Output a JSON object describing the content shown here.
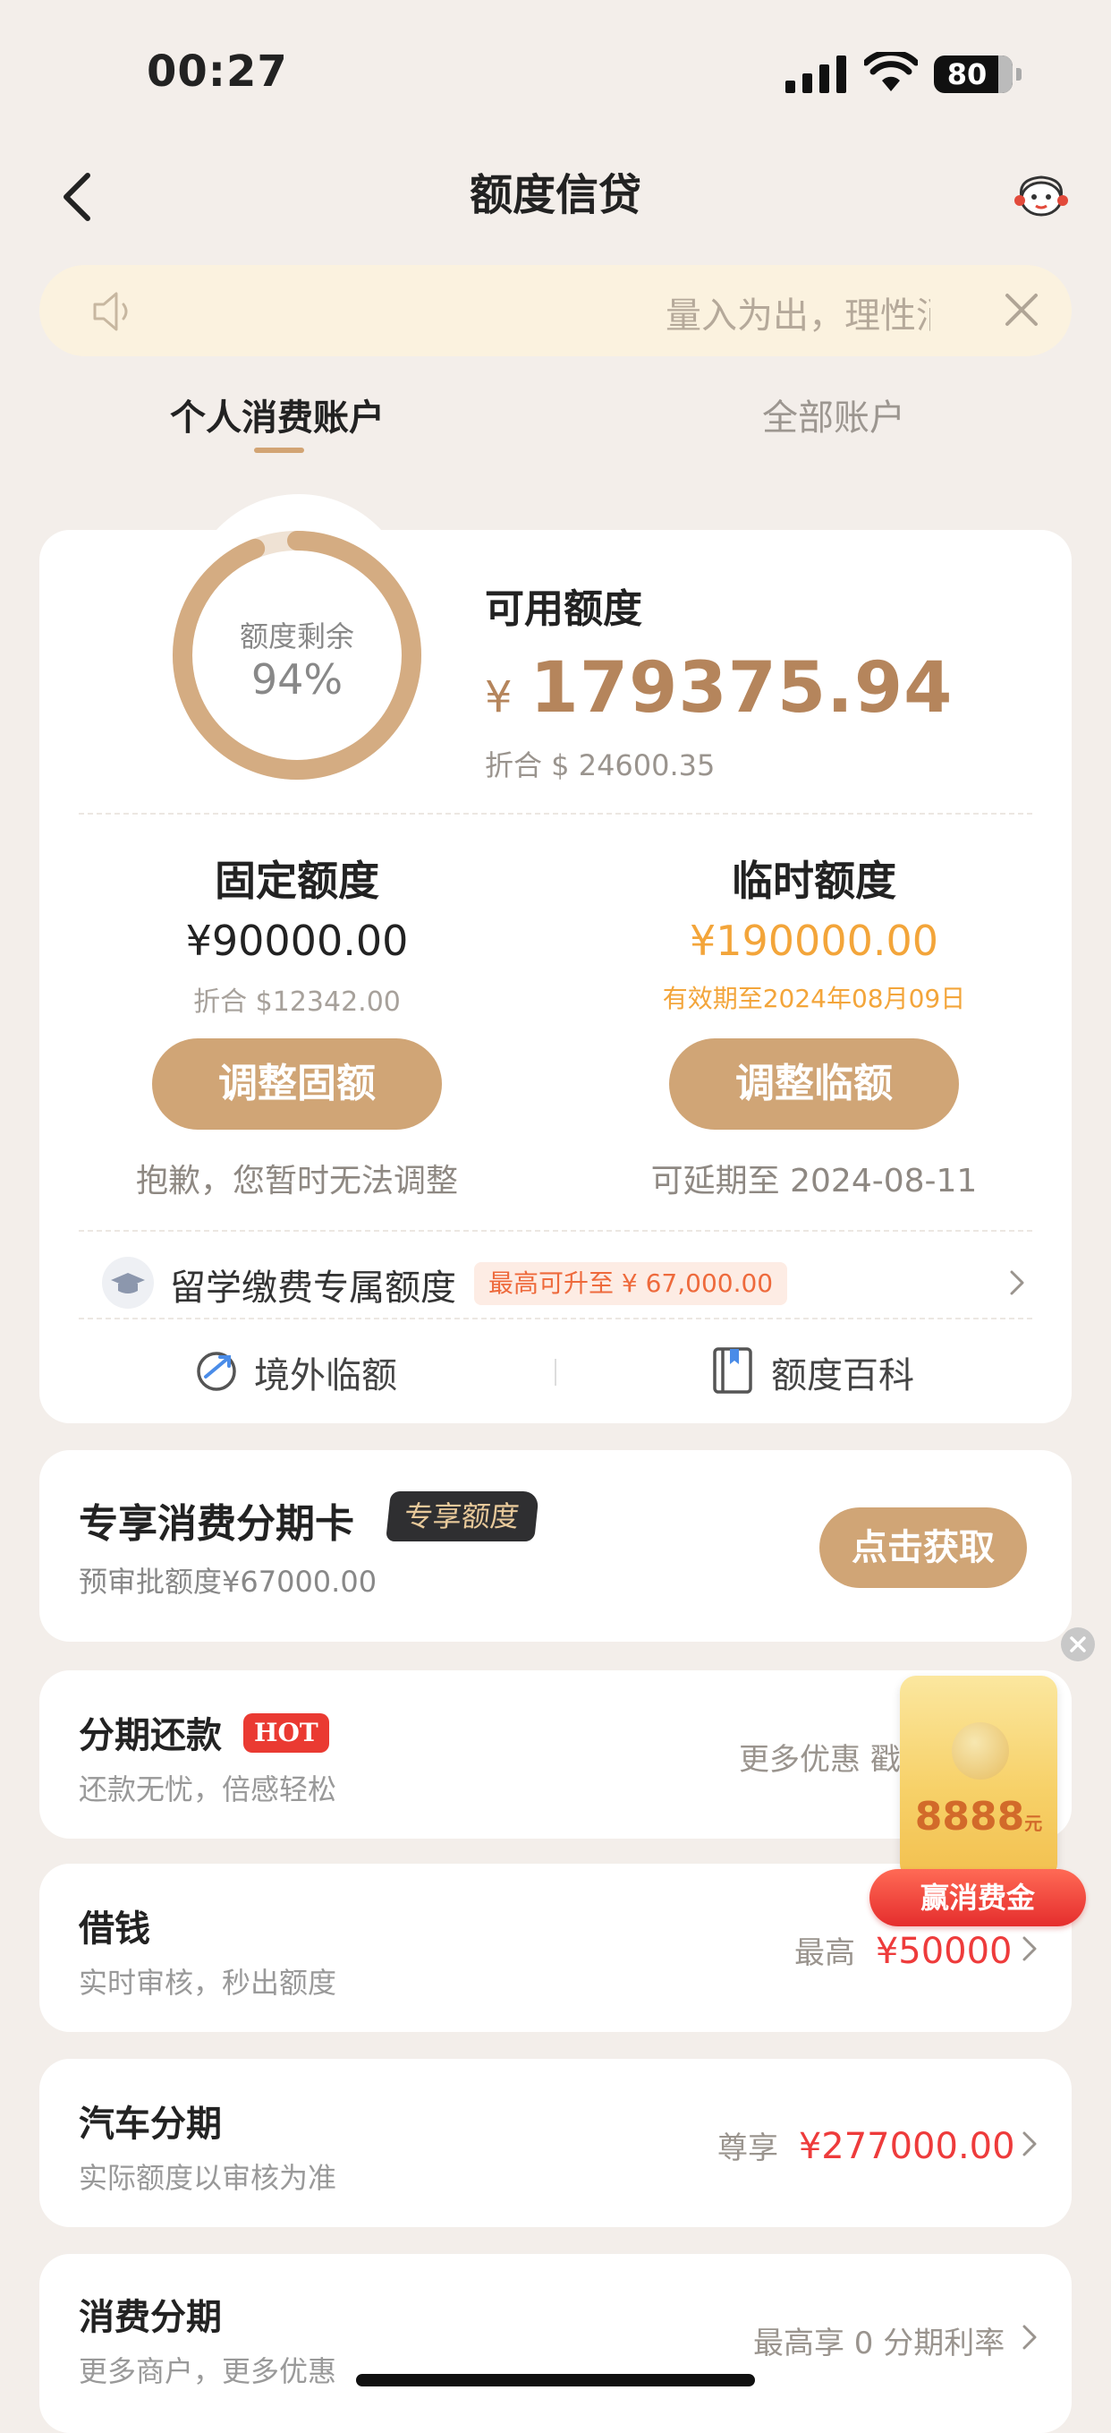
{
  "status": {
    "time": "00:27",
    "battery": "80"
  },
  "nav": {
    "title": "额度信贷"
  },
  "notice": {
    "text": "量入为出，理性消费"
  },
  "tabs": [
    {
      "label": "个人消费账户"
    },
    {
      "label": "全部账户"
    }
  ],
  "credit": {
    "ring_label": "额度剩余",
    "ring_percent_text": "94%",
    "ring_percent": 0.94,
    "available_label": "可用额度",
    "currency": "¥",
    "available_amount": "179375.94",
    "available_usd": "折合 $ 24600.35",
    "fixed": {
      "title": "固定额度",
      "amount": "¥90000.00",
      "usd": "折合 $12342.00",
      "button": "调整固额",
      "note": "抱歉，您暂时无法调整"
    },
    "temporary": {
      "title": "临时额度",
      "amount": "¥190000.00",
      "validity": "有效期至2024年08月09日",
      "button": "调整临额",
      "note": "可延期至 2024-08-11"
    },
    "study": {
      "title": "留学缴费专属额度",
      "badge": "最高可升至 ¥ 67,000.00"
    },
    "tools": [
      {
        "label": "境外临额"
      },
      {
        "label": "额度百科"
      }
    ]
  },
  "installment_card": {
    "title": "专享消费分期卡",
    "badge": "专享额度",
    "subtitle": "预审批额度¥67000.00",
    "button": "点击获取"
  },
  "list": [
    {
      "title": "分期还款",
      "badge": "HOT",
      "subtitle": "还款无忧，倍感轻松",
      "right_text": "更多优惠 戳"
    },
    {
      "title": "借钱",
      "subtitle": "实时审核，秒出额度",
      "right_prefix": "最高",
      "right_value": "¥50000"
    },
    {
      "title": "汽车分期",
      "subtitle": "实际额度以审核为准",
      "right_prefix": "尊享",
      "right_value": "¥277000.00"
    },
    {
      "title": "消费分期",
      "subtitle": "更多商户，更多优惠",
      "right_text": "最高享 0 分期利率"
    }
  ],
  "promo": {
    "amount": "8888",
    "unit": "元",
    "button": "赢消费金"
  },
  "colors": {
    "accent": "#d0a576",
    "gold_text": "#b5855c",
    "orange": "#f3a53a",
    "red": "#ee3b3b",
    "background": "#f3eeea"
  }
}
